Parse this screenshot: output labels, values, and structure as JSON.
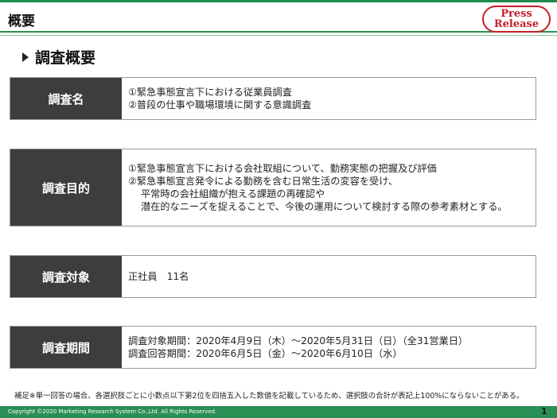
{
  "header": {
    "title": "概要",
    "badge_line1": "Press",
    "badge_line2": "Release"
  },
  "section": {
    "title": "調査概要"
  },
  "rows": [
    {
      "label": "調査名",
      "lines": [
        "①緊急事態宣言下における従業員調査",
        "②普段の仕事や職場環境に関する意識調査"
      ]
    },
    {
      "label": "調査目的",
      "lines": [
        "①緊急事態宣言下における会社取組について、勤務実態の把握及び評価",
        "②緊急事態宣言発令による勤務を含む日常生活の変容を受け、",
        "平常時の会社組織が抱える課題の再確認や",
        "潜在的なニーズを捉えることで、今後の運用について検討する際の参考素材とする。"
      ]
    },
    {
      "label": "調査対象",
      "lines": [
        "正社員　11名"
      ]
    },
    {
      "label": "調査期間",
      "lines": [
        "調査対象期間：2020年4月9日（木）～2020年5月31日（日）（全31営業日）",
        "調査回答期間：2020年6月5日（金）～2020年6月10日（水）"
      ]
    }
  ],
  "footnote": "補足※単一回答の場合、各選択肢ごとに小数点以下第2位を四捨五入した数値を記載しているため、選択肢の合計が表記上100%にならないことがある。",
  "footer": {
    "copyright": "Copyright ©2020 Marketing Research System Co.,Ltd. All Rights Reserved.",
    "page_number": "1"
  }
}
